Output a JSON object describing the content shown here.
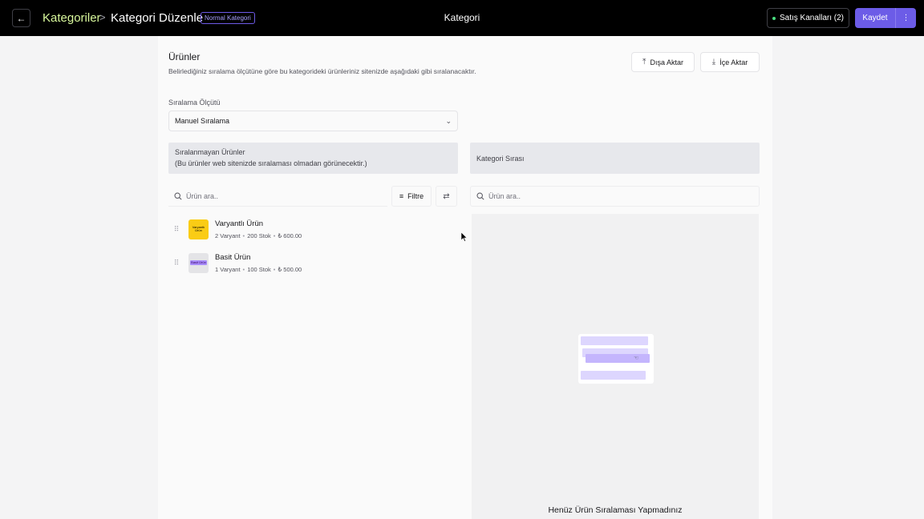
{
  "header": {
    "back_icon": "arrow-left-icon",
    "breadcrumb_root": "Kategoriler",
    "breadcrumb_separator": ">",
    "breadcrumb_current": "Kategori Düzenle",
    "badge": "Normal Kategori",
    "title": "Kategori",
    "channels_label": "Satış Kanalları (2)",
    "save_label": "Kaydet",
    "more_icon": "⋮"
  },
  "section": {
    "title": "Ürünler",
    "description": "Belirlediğiniz sıralama ölçütüne göre bu kategorideki ürünleriniz sitenizde aşağıdaki gibi sıralanacaktır.",
    "export_label": "Dışa Aktar",
    "import_label": "İçe Aktar"
  },
  "sort": {
    "label": "Sıralama Ölçütü",
    "selected": "Manuel Sıralama"
  },
  "left_column": {
    "title": "Sıralanmayan Ürünler",
    "subtitle": "(Bu ürünler web sitenizde sıralaması olmadan görünecektir.)",
    "search_placeholder": "Ürün ara..",
    "filter_label": "Filtre",
    "products": [
      {
        "name": "Varyantlı Ürün",
        "thumb_text": "Varyantlı Ürün",
        "variants": "2 Varyant",
        "stock": "200 Stok",
        "price": "₺ 600.00"
      },
      {
        "name": "Basit Ürün",
        "thumb_text": "Basit Ürün",
        "variants": "1 Varyant",
        "stock": "100 Stok",
        "price": "₺ 500.00"
      }
    ]
  },
  "right_column": {
    "title": "Kategori Sırası",
    "search_placeholder": "Ürün ara..",
    "empty_title": "Henüz Ürün Sıralaması Yapmadınız"
  },
  "colors": {
    "accent": "#6c5ce7",
    "topbar": "#000000",
    "breadcrumb_root": "#d9f99d",
    "thumb_yellow": "#facc15"
  }
}
